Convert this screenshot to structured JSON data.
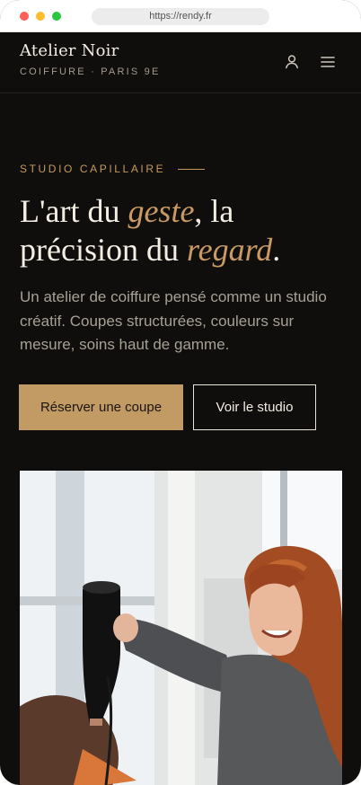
{
  "browser": {
    "url": "https://rendy.fr"
  },
  "header": {
    "brand_name": "Atelier Noir",
    "tagline": "COIFFURE · PARIS 9E",
    "account_icon": "user-icon",
    "menu_icon": "menu-icon"
  },
  "hero": {
    "eyebrow": "STUDIO CAPILLAIRE",
    "headline": {
      "part1": "L'art du ",
      "accent1": "geste",
      "part2": ", la précision du ",
      "accent2": "regard",
      "part3": "."
    },
    "lead": "Un atelier de coiffure pensé comme un studio créatif. Coupes structurées, couleurs sur mesure, soins haut de gamme.",
    "primary_cta": "Réserver une coupe",
    "secondary_cta": "Voir le studio"
  },
  "colors": {
    "background": "#0f0e0c",
    "accent": "#c29a64",
    "text": "#f3ede3",
    "muted": "#a7a094"
  }
}
